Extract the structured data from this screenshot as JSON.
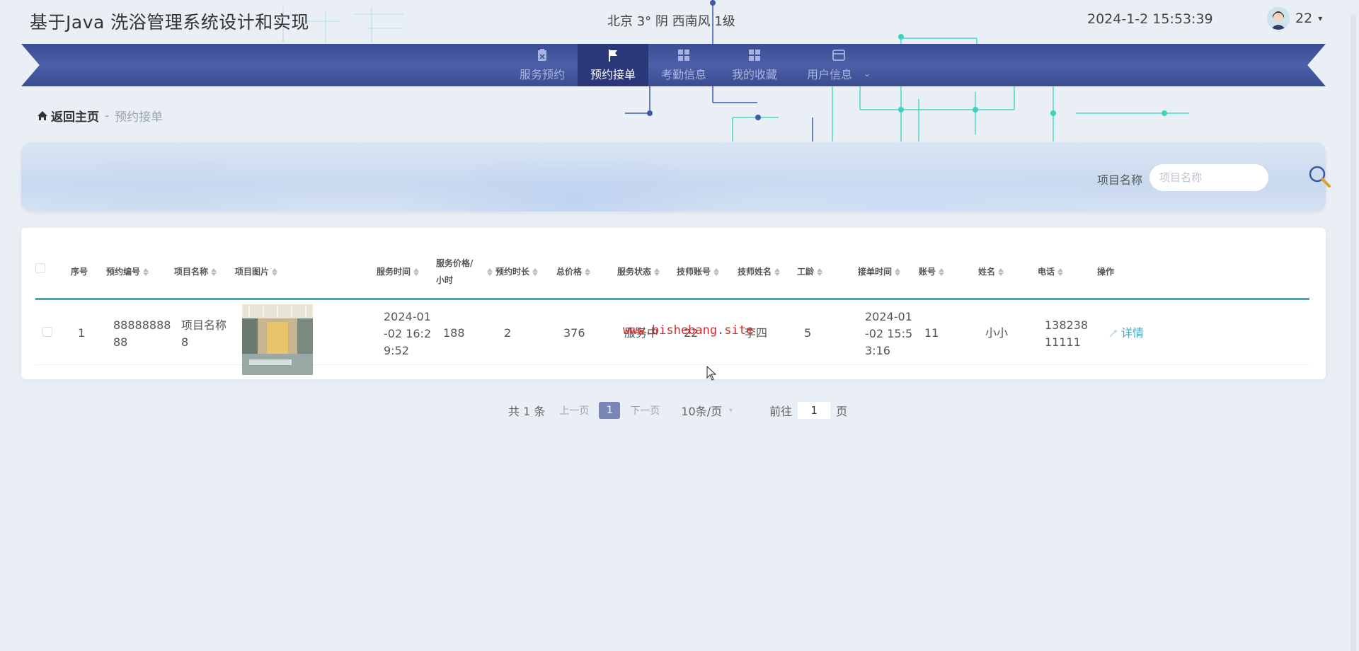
{
  "header": {
    "site_title": "基于Java 洗浴管理系统设计和实现",
    "weather": "北京  3°  阴  西南风  1级",
    "clock": "2024-1-2 15:53:39",
    "username": "22",
    "caret": "▾"
  },
  "nav": {
    "items": [
      {
        "label": "服务预约",
        "icon": "clipboard-icon"
      },
      {
        "label": "预约接单",
        "icon": "flag-icon"
      },
      {
        "label": "考勤信息",
        "icon": "grid-icon"
      },
      {
        "label": "我的收藏",
        "icon": "grid-icon"
      },
      {
        "label": "用户信息",
        "icon": "card-icon"
      }
    ],
    "active_index": 1,
    "dropdown_caret": "⌄"
  },
  "breadcrumb": {
    "home": "返回主页",
    "sep": "-",
    "current": "预约接单"
  },
  "search": {
    "label": "项目名称",
    "placeholder": "项目名称"
  },
  "table": {
    "columns": [
      "序号",
      "预约编号",
      "项目名称",
      "项目图片",
      "服务时间",
      "服务价格/小时",
      "预约时长",
      "总价格",
      "服务状态",
      "技师账号",
      "技师姓名",
      "工龄",
      "接单时间",
      "账号",
      "姓名",
      "电话",
      "操作"
    ],
    "rows": [
      {
        "index": "1",
        "order_no": "8888888888",
        "project_name": "项目名称8",
        "service_time": "2024-01-02 16:29:52",
        "price_per_hour": "188",
        "duration": "2",
        "total": "376",
        "status": "服务中",
        "tech_account": "22",
        "tech_name": "李四",
        "seniority": "5",
        "accept_time": "2024-01-02 15:53:16",
        "account": "11",
        "name": "小小",
        "phone": "13823811111",
        "action": "详情"
      }
    ]
  },
  "watermark": "www.bishebang.site",
  "pagination": {
    "total": "共 1 条",
    "prev": "上一页",
    "page": "1",
    "next": "下一页",
    "page_size": "10条/页",
    "goto_label": "前往",
    "goto_value": "1",
    "goto_suffix": "页"
  },
  "colors": {
    "nav_bg": "#4657a0",
    "nav_active": "#2a3779",
    "accent": "#3fa8c7",
    "watermark": "#d42a2a"
  }
}
